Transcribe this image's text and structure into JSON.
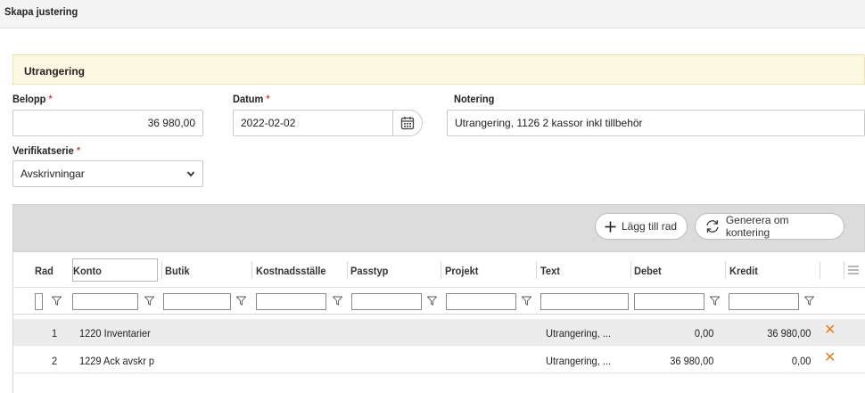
{
  "page": {
    "title": "Skapa justering"
  },
  "section": {
    "title": "Utrangering"
  },
  "form": {
    "belopp": {
      "label": "Belopp",
      "required_mark": "*",
      "value": "36 980,00"
    },
    "datum": {
      "label": "Datum",
      "required_mark": "*",
      "value": "2022-02-02",
      "icon": "calendar-icon"
    },
    "notering": {
      "label": "Notering",
      "value": "Utrangering, 1126 2 kassor inkl tillbehör"
    },
    "verifikatserie": {
      "label": "Verifikatserie",
      "required_mark": "*",
      "selected": "Avskrivningar"
    }
  },
  "toolbar": {
    "add_row_label": "Lägg till rad",
    "regenerate_label": "Generera om kontering"
  },
  "grid": {
    "columns": [
      "Rad",
      "Konto",
      "Butik",
      "Kostnadsställe",
      "Passtyp",
      "Projekt",
      "Text",
      "Debet",
      "Kredit"
    ],
    "rows": [
      {
        "rad": "1",
        "konto": "1220 Inventarier",
        "text": "Utrangering, ...",
        "debet": "0,00",
        "kredit": "36 980,00"
      },
      {
        "rad": "2",
        "konto": "1229 Ack avskr p",
        "text": "Utrangering, ...",
        "debet": "36 980,00",
        "kredit": "0,00"
      }
    ],
    "delete_symbol": "✕"
  },
  "colors": {
    "accent_delete": "#ee7a1c",
    "required": "#d0021b",
    "banner": "#fcf7e0"
  }
}
